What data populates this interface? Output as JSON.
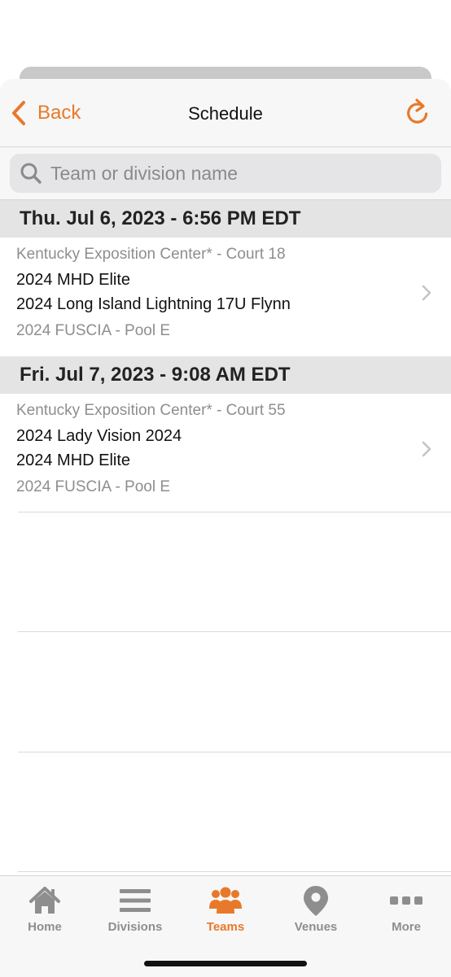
{
  "colors": {
    "accent": "#e8792b",
    "inactive": "#8e8e8e"
  },
  "header": {
    "back_label": "Back",
    "title": "Schedule",
    "refresh_icon": "refresh-icon"
  },
  "search": {
    "placeholder": "Team or division name",
    "value": ""
  },
  "schedule": [
    {
      "day_header": "Thu. Jul 6, 2023 - 6:56 PM EDT",
      "venue": "Kentucky Exposition Center* - Court 18",
      "team1": "2024 MHD Elite",
      "team2": "2024 Long Island Lightning 17U Flynn",
      "division": "2024 FUSCIA - Pool E"
    },
    {
      "day_header": "Fri. Jul 7, 2023 - 9:08 AM EDT",
      "venue": "Kentucky Exposition Center* - Court 55",
      "team1": "2024 Lady Vision 2024",
      "team2": "2024 MHD Elite",
      "division": "2024 FUSCIA - Pool E"
    }
  ],
  "tabs": [
    {
      "label": "Home",
      "icon": "home-icon",
      "active": false
    },
    {
      "label": "Divisions",
      "icon": "list-icon",
      "active": false
    },
    {
      "label": "Teams",
      "icon": "people-icon",
      "active": true
    },
    {
      "label": "Venues",
      "icon": "location-pin-icon",
      "active": false
    },
    {
      "label": "More",
      "icon": "more-dots-icon",
      "active": false
    }
  ]
}
